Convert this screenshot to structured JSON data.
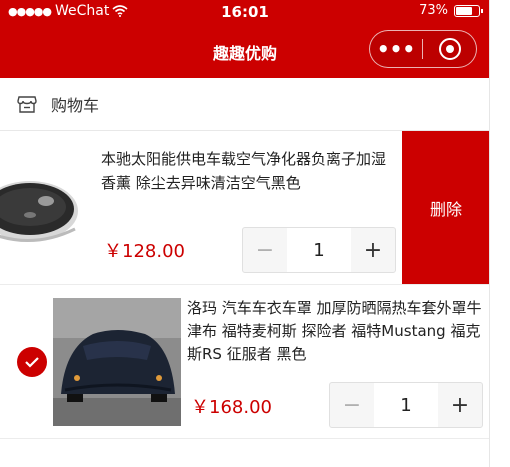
{
  "status_bar": {
    "carrier": "WeChat",
    "time": "16:01",
    "battery_percent": "73%",
    "battery_level": 0.73
  },
  "nav": {
    "title": "趣趣优购",
    "more_icon": "more-dots-icon",
    "close_icon": "target-circle-icon"
  },
  "header": {
    "icon": "store-icon",
    "title": "购物车"
  },
  "items": [
    {
      "title": "本驰太阳能供电车载空气净化器负离子加湿香薰 除尘去异味清洁空气黑色",
      "price": "￥128.00",
      "quantity": "1",
      "minus": "−",
      "plus": "+",
      "delete_label": "删除",
      "checked": false
    },
    {
      "title": "洛玛 汽车车衣车罩 加厚防晒隔热车套外罩牛津布 福特麦柯斯 探险者 福特Mustang 福克斯RS 征服者 黑色",
      "price": "￥168.00",
      "quantity": "1",
      "minus": "−",
      "plus": "+",
      "checked": true
    }
  ],
  "colors": {
    "brand": "#cc0000",
    "text": "#222222",
    "muted": "#b0b0b0"
  }
}
